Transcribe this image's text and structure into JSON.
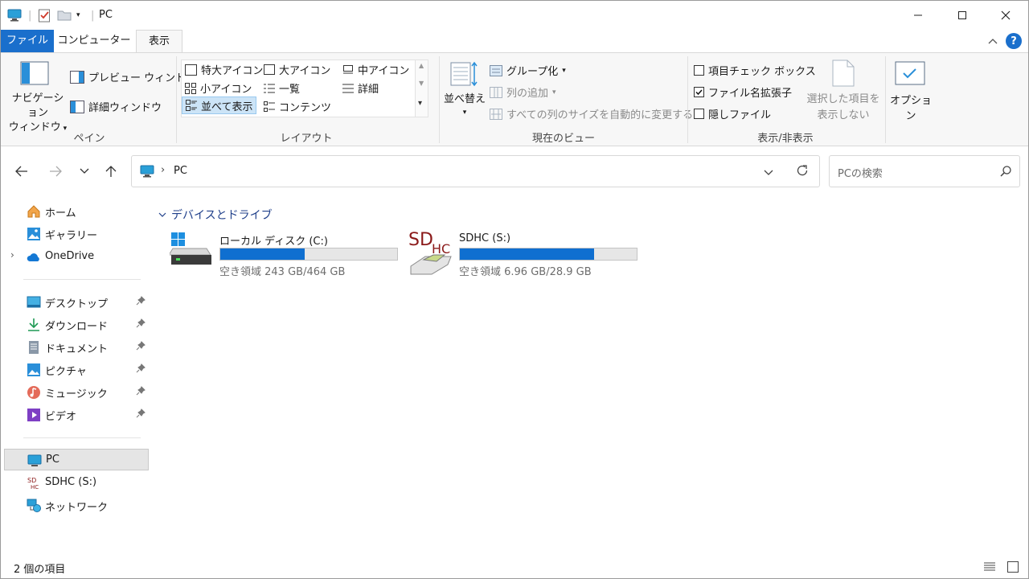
{
  "titlebar": {
    "title": "PC"
  },
  "tabs": {
    "file": "ファイル",
    "computer": "コンピューター",
    "view": "表示"
  },
  "ribbon": {
    "pane": {
      "nav_pane": "ナビゲーション",
      "nav_pane2": "ウィンドウ",
      "preview_pane": "プレビュー ウィンドウ",
      "details_pane": "詳細ウィンドウ",
      "label": "ペイン"
    },
    "layout": {
      "xl_icons": "特大アイコン",
      "large_icons": "大アイコン",
      "medium_icons": "中アイコン",
      "small_icons": "小アイコン",
      "list": "一覧",
      "details": "詳細",
      "tiles": "並べて表示",
      "content": "コンテンツ",
      "label": "レイアウト"
    },
    "current_view": {
      "sort": "並べ替え",
      "group": "グループ化",
      "add_column": "列の追加",
      "size_all": "すべての列のサイズを自動的に変更する",
      "label": "現在のビュー"
    },
    "show_hide": {
      "item_checkboxes": "項目チェック ボックス",
      "file_ext": "ファイル名拡張子",
      "hidden_items": "隠しファイル",
      "hide_selected_1": "選択した項目を",
      "hide_selected_2": "表示しない",
      "label": "表示/非表示",
      "item_checkboxes_checked": false,
      "file_ext_checked": true,
      "hidden_items_checked": false
    },
    "options": "オプション"
  },
  "address": {
    "location": "PC",
    "search_placeholder": "PCの検索"
  },
  "sidebar": {
    "quick": [
      {
        "label": "ホーム"
      },
      {
        "label": "ギャラリー"
      },
      {
        "label": "OneDrive"
      }
    ],
    "pinned": [
      {
        "label": "デスクトップ"
      },
      {
        "label": "ダウンロード"
      },
      {
        "label": "ドキュメント"
      },
      {
        "label": "ピクチャ"
      },
      {
        "label": "ミュージック"
      },
      {
        "label": "ビデオ"
      }
    ],
    "devices": [
      {
        "label": "PC"
      },
      {
        "label": "SDHC (S:)"
      },
      {
        "label": "ネットワーク"
      }
    ]
  },
  "content": {
    "group_header": "デバイスとドライブ",
    "drives": [
      {
        "name": "ローカル ディスク (C:)",
        "free_text": "空き領域 243 GB/464 GB",
        "used_fraction": 0.476
      },
      {
        "name": "SDHC (S:)",
        "free_text": "空き領域 6.96 GB/28.9 GB",
        "used_fraction": 0.759
      }
    ],
    "sdhc_logo": "SDHC"
  },
  "status": {
    "count": "2 個の項目"
  },
  "colors": {
    "accent": "#1a6fcc",
    "drive_fill": "#0f6fd0",
    "selection": "#cce4f7"
  }
}
